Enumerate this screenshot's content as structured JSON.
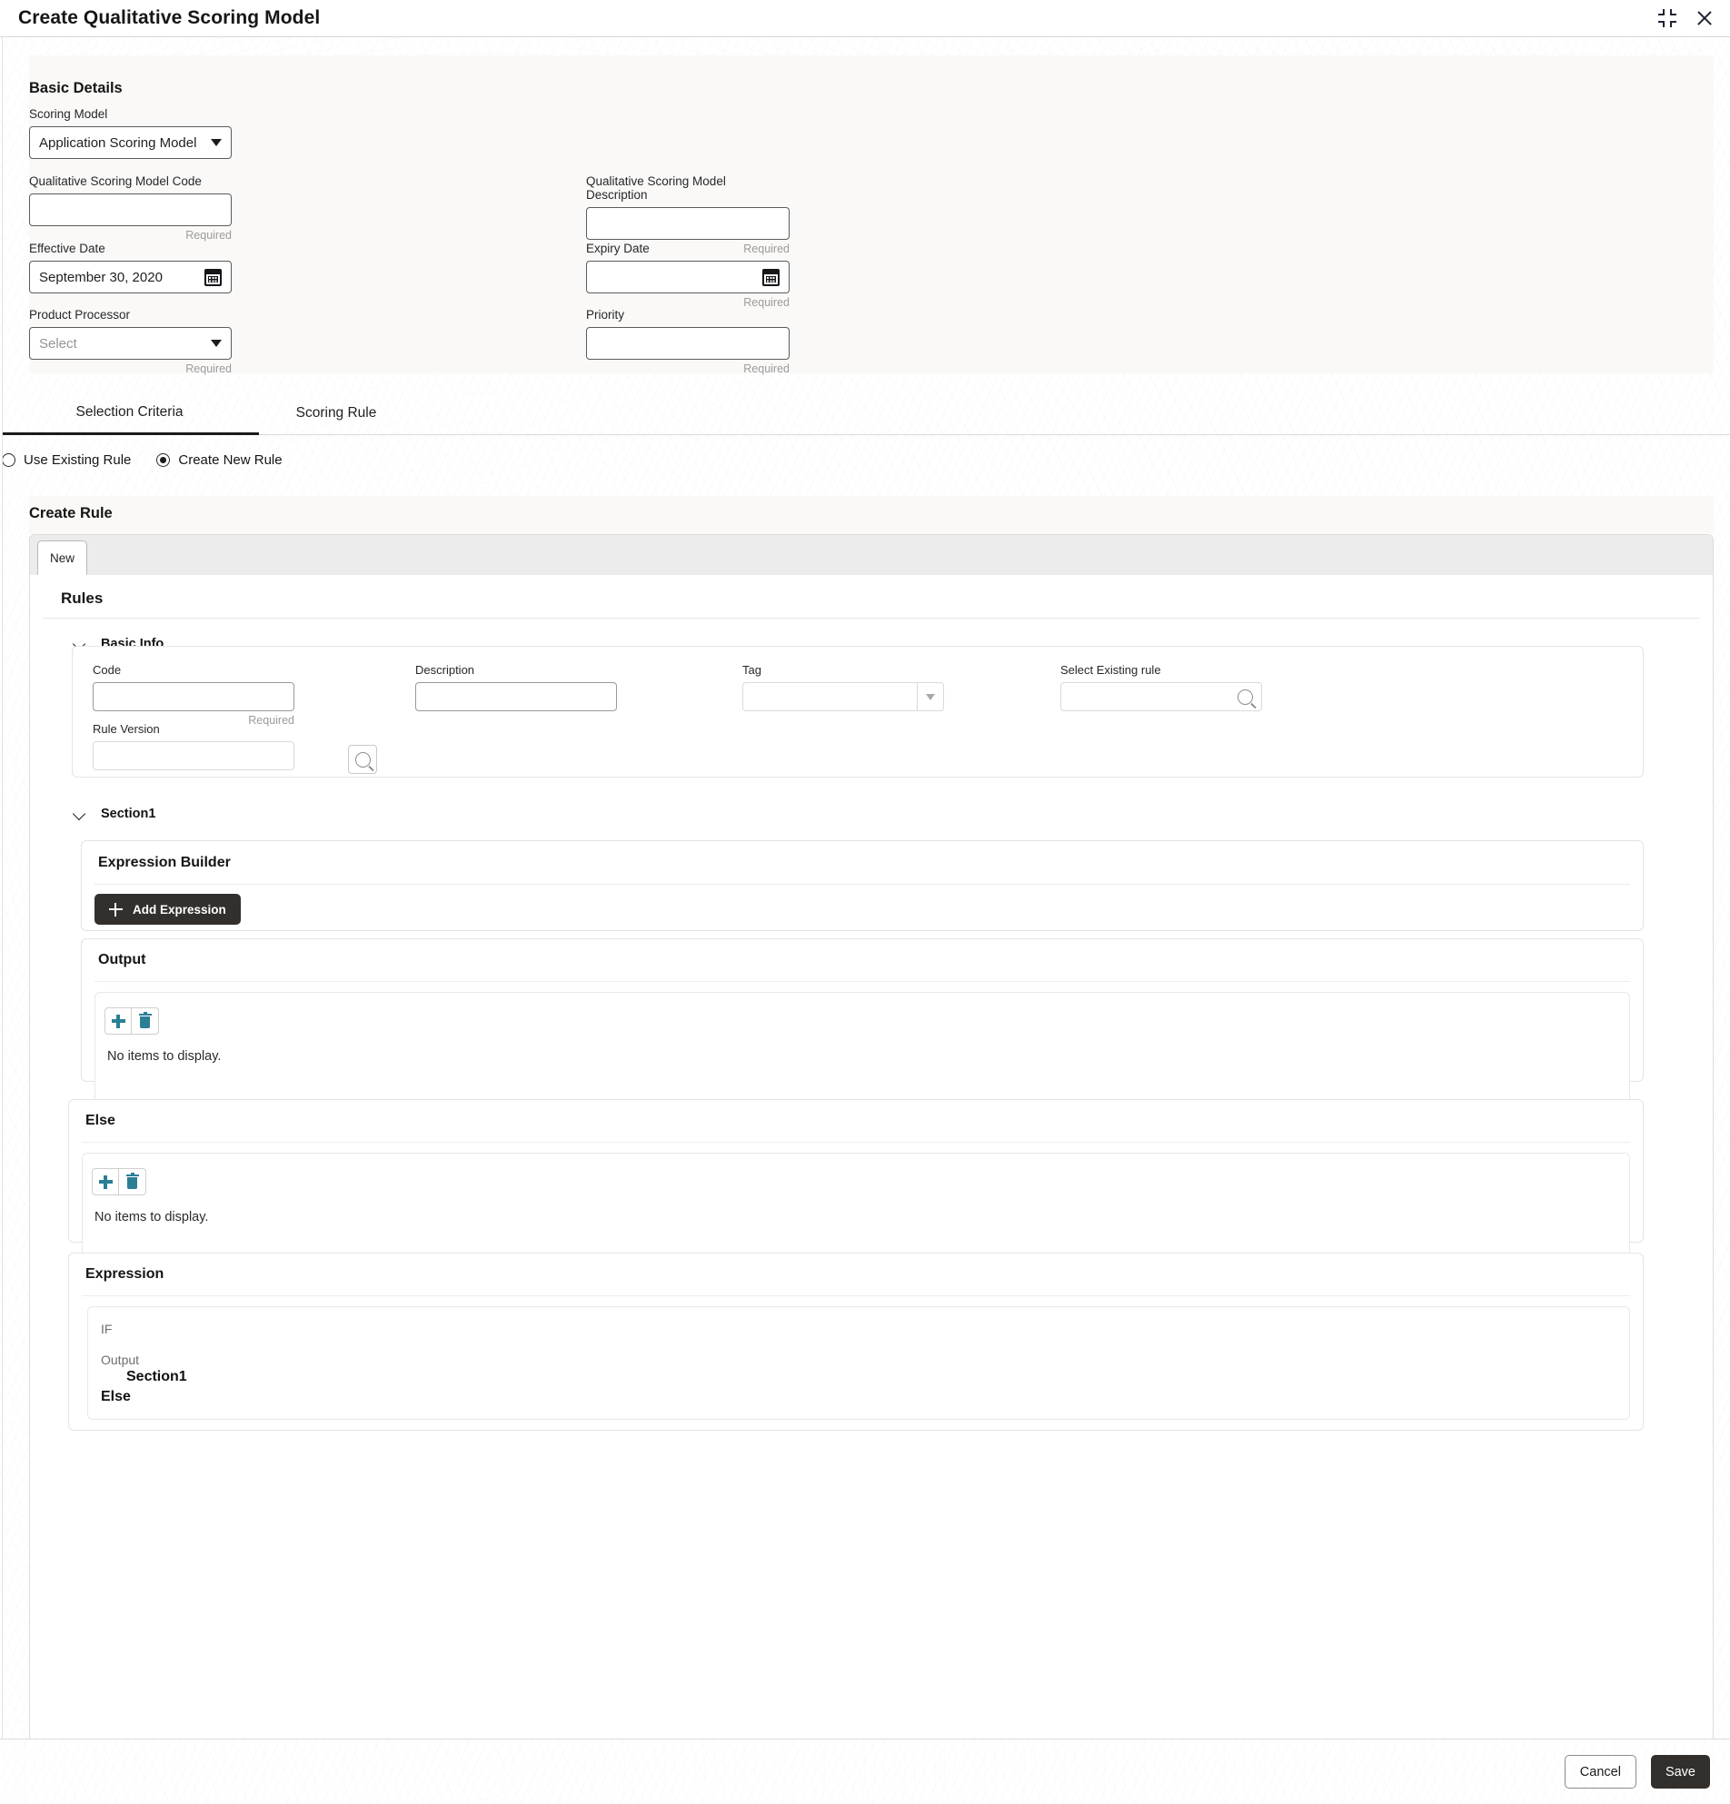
{
  "window": {
    "title": "Create Qualitative Scoring Model",
    "collapse_icon": "collapse-corners-icon",
    "close_icon": "close-icon"
  },
  "basic_details": {
    "heading": "Basic Details",
    "fields": {
      "scoring_model": {
        "label": "Scoring Model",
        "value": "Application Scoring Model",
        "type": "select"
      },
      "model_code": {
        "label": "Qualitative Scoring Model Code",
        "value": "",
        "hint": "Required",
        "type": "text"
      },
      "model_description": {
        "label": "Qualitative Scoring Model Description",
        "value": "",
        "hint": "Required",
        "type": "text"
      },
      "effective_date": {
        "label": "Effective Date",
        "value": "September 30, 2020",
        "hint": "",
        "type": "date"
      },
      "expiry_date": {
        "label": "Expiry Date",
        "value": "",
        "hint": "Required",
        "type": "date"
      },
      "product_processor": {
        "label": "Product Processor",
        "value": "",
        "placeholder": "Select",
        "hint": "Required",
        "type": "select"
      },
      "priority": {
        "label": "Priority",
        "value": "",
        "hint": "Required",
        "type": "text"
      }
    }
  },
  "tabs": [
    {
      "label": "Selection Criteria",
      "active": true
    },
    {
      "label": "Scoring Rule",
      "active": false
    }
  ],
  "rule_mode": {
    "options": [
      {
        "label": "Use Existing Rule",
        "selected": false
      },
      {
        "label": "Create New Rule",
        "selected": true
      }
    ]
  },
  "create_rule": {
    "heading": "Create Rule",
    "tab_label": "New",
    "rules_heading": "Rules",
    "basic_info": {
      "heading": "Basic Info",
      "code": {
        "label": "Code",
        "value": "",
        "hint": "Required"
      },
      "description": {
        "label": "Description",
        "value": ""
      },
      "tag": {
        "label": "Tag",
        "value": ""
      },
      "select_existing_rule": {
        "label": "Select Existing rule",
        "value": ""
      },
      "rule_version": {
        "label": "Rule Version",
        "value": ""
      },
      "search_button_icon": "search-icon"
    },
    "section1": {
      "heading": "Section1",
      "expression_builder": {
        "heading": "Expression Builder",
        "add_expression_label": "Add Expression"
      },
      "output": {
        "heading": "Output",
        "empty_text": "No items to display.",
        "add_icon": "plus-icon",
        "delete_icon": "trash-icon"
      }
    },
    "else_block": {
      "heading": "Else",
      "empty_text": "No items to display.",
      "add_icon": "plus-icon",
      "delete_icon": "trash-icon"
    },
    "expression_preview": {
      "heading": "Expression",
      "if_label": "IF",
      "output_label": "Output",
      "output_value": "Section1",
      "else_label": "Else"
    }
  },
  "footer": {
    "cancel_label": "Cancel",
    "save_label": "Save"
  },
  "colors": {
    "accent_teal": "#2b7f95",
    "dark_button": "#332f2d",
    "panel_bg": "#faf9f7"
  }
}
